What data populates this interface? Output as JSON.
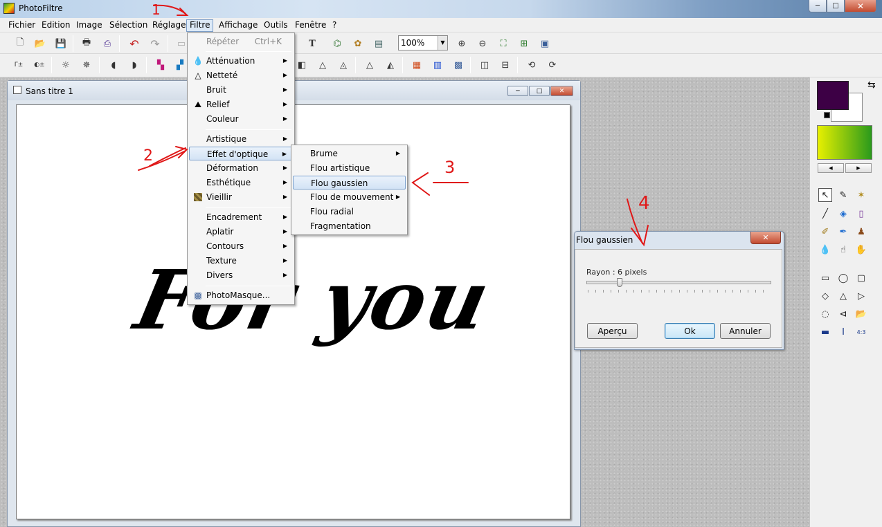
{
  "app": {
    "title": "PhotoFiltre"
  },
  "window_controls": {
    "minimize": "─",
    "maximize": "□",
    "close": "✕"
  },
  "menubar": [
    {
      "label": "Fichier"
    },
    {
      "label": "Edition"
    },
    {
      "label": "Image"
    },
    {
      "label": "Sélection"
    },
    {
      "label": "Réglage"
    },
    {
      "label": "Filtre"
    },
    {
      "label": "Affichage"
    },
    {
      "label": "Outils"
    },
    {
      "label": "Fenêtre"
    },
    {
      "label": "?"
    }
  ],
  "toolbar": {
    "zoom_value": "100%"
  },
  "document": {
    "title": "Sans titre 1",
    "canvas_text": "For you"
  },
  "filtre_menu": {
    "repeat": {
      "label": "Répéter",
      "shortcut": "Ctrl+K"
    },
    "items": [
      {
        "label": "Atténuation",
        "icon": "drop-icon"
      },
      {
        "label": "Netteté",
        "icon": "drop-outline-icon"
      },
      {
        "label": "Bruit"
      },
      {
        "label": "Relief",
        "icon": "relief-icon"
      },
      {
        "label": "Couleur"
      },
      {
        "label": "Artistique"
      },
      {
        "label": "Effet d'optique"
      },
      {
        "label": "Déformation"
      },
      {
        "label": "Esthétique"
      },
      {
        "label": "Vieillir",
        "icon": "texture-icon"
      },
      {
        "label": "Encadrement"
      },
      {
        "label": "Aplatir"
      },
      {
        "label": "Contours"
      },
      {
        "label": "Texture"
      },
      {
        "label": "Divers"
      },
      {
        "label": "PhotoMasque...",
        "icon": "photomasque-icon"
      }
    ]
  },
  "optique_submenu": {
    "items": [
      {
        "label": "Brume"
      },
      {
        "label": "Flou artistique"
      },
      {
        "label": "Flou gaussien"
      },
      {
        "label": "Flou de mouvement"
      },
      {
        "label": "Flou radial"
      },
      {
        "label": "Fragmentation"
      }
    ]
  },
  "dialog": {
    "title": "Flou gaussien",
    "rayon_label": "Rayon : 6 pixels",
    "buttons": {
      "apercu": "Aperçu",
      "ok": "Ok",
      "annuler": "Annuler"
    }
  },
  "colors": {
    "foreground": "#3d0045",
    "background": "#ffffff",
    "gradient_start": "#e8f000",
    "gradient_end": "#2a9a1c"
  },
  "annotations": [
    "1",
    "2",
    "3",
    "4"
  ]
}
